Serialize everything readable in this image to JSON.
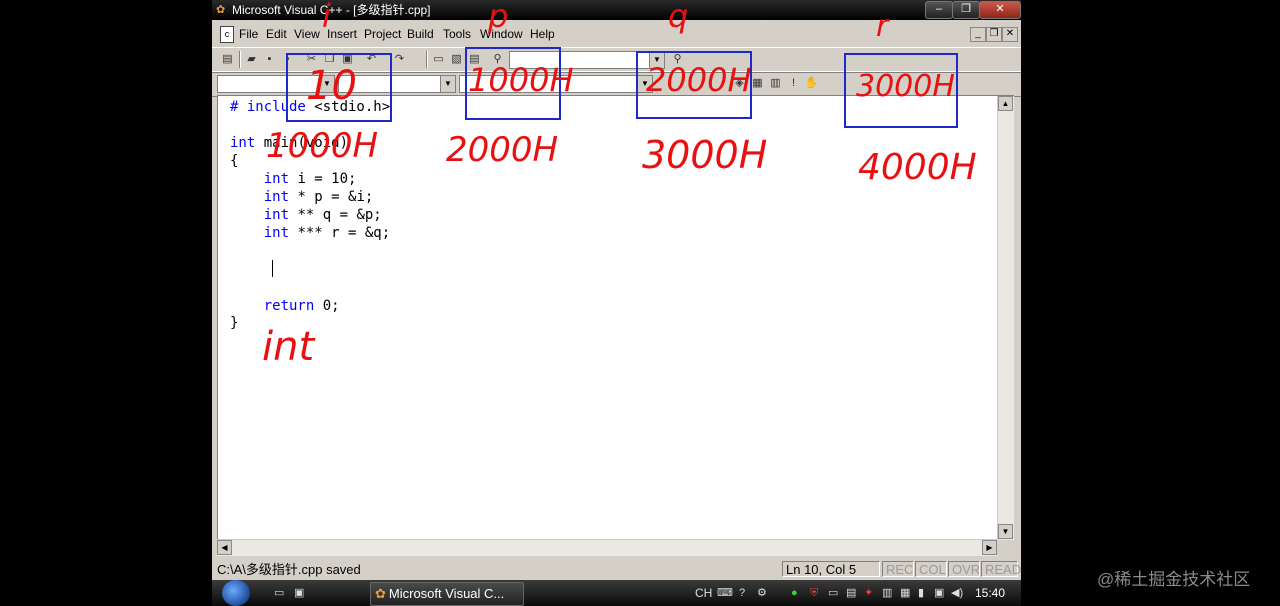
{
  "window": {
    "title": "Microsoft Visual C++ - [多级指针.cpp]",
    "minimize_glyph": "–",
    "restore_glyph": "❐",
    "close_glyph": "✕"
  },
  "menu": {
    "items": [
      "File",
      "Edit",
      "View",
      "Insert",
      "Project",
      "Build",
      "Tools",
      "Window",
      "Help"
    ],
    "mdi_minimize": "_",
    "mdi_restore": "❐",
    "mdi_close": "✕"
  },
  "editor": {
    "lines": [
      {
        "kw": "# include",
        "rest": " <stdio.h>"
      },
      {
        "kw": "",
        "rest": ""
      },
      {
        "kw": "int",
        "rest": " main(void)"
      },
      {
        "kw": "",
        "rest": "{"
      },
      {
        "kw": "    int",
        "rest": " i = 10;"
      },
      {
        "kw": "    int",
        "rest": " * p = &i;"
      },
      {
        "kw": "    int",
        "rest": " ** q = &p;"
      },
      {
        "kw": "    int",
        "rest": " *** r = &q;"
      },
      {
        "kw": "",
        "rest": ""
      },
      {
        "kw": "",
        "rest": ""
      },
      {
        "kw": "",
        "rest": ""
      },
      {
        "kw": "    return",
        "rest": " 0;"
      },
      {
        "kw": "",
        "rest": "}"
      }
    ]
  },
  "statusbar": {
    "message": "C:\\A\\多级指针.cpp saved",
    "position": "Ln 10, Col 5",
    "indicators": [
      "REC",
      "COL",
      "OVR",
      "READ"
    ]
  },
  "taskbar": {
    "task_label": "Microsoft Visual C...",
    "language": "CH",
    "clock": "15:40"
  },
  "annotations": {
    "var_i": "i",
    "var_p": "p",
    "var_q": "q",
    "var_r": "r",
    "box_i_value": "10",
    "box_p_value": "1000H",
    "box_q_value": "2000H",
    "box_r_value": "3000H",
    "addr_i": "1000H",
    "addr_p": "2000H",
    "addr_q": "3000H",
    "addr_r": "4000H",
    "type_note": "int",
    "annotation_color": "#e81010",
    "box_color": "#1f28c8"
  },
  "watermark": "@稀土掘金技术社区"
}
